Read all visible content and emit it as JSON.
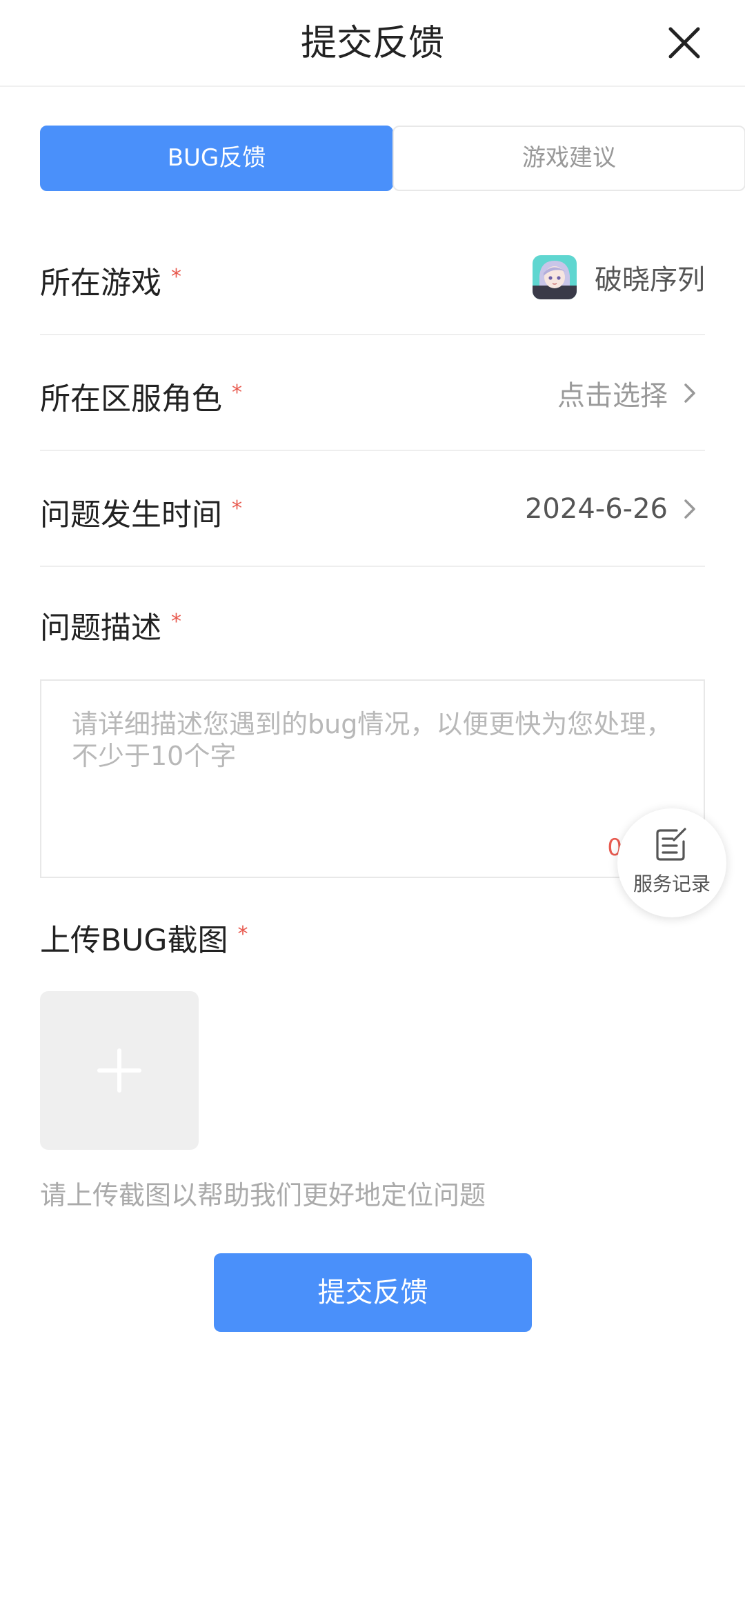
{
  "header": {
    "title": "提交反馈",
    "close_icon": "close-icon"
  },
  "tabs": [
    {
      "label": "BUG反馈",
      "active": true
    },
    {
      "label": "游戏建议",
      "active": false
    }
  ],
  "form": {
    "game": {
      "label": "所在游戏",
      "required": "*",
      "value": "破晓序列",
      "icon": "game-avatar-icon"
    },
    "server_role": {
      "label": "所在区服角色",
      "required": "*",
      "value": "点击选择"
    },
    "time": {
      "label": "问题发生时间",
      "required": "*",
      "value": "2024-6-26"
    },
    "description": {
      "label": "问题描述",
      "required": "*",
      "placeholder": "请详细描述您遇到的bug情况，以便更快为您处理，不少于10个字",
      "char_count": "0"
    },
    "upload": {
      "label": "上传BUG截图",
      "required": "*",
      "hint": "请上传截图以帮助我们更好地定位问题",
      "add_icon": "plus-icon"
    }
  },
  "floating": {
    "label": "服务记录",
    "icon": "edit-note-icon"
  },
  "submit": {
    "label": "提交反馈"
  },
  "colors": {
    "accent": "#4a90fa",
    "required": "#e85a4f",
    "placeholder": "#b8b8b8"
  }
}
